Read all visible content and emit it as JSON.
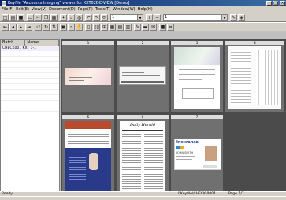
{
  "window": {
    "title": "Keyfile \"Accounts Imaging\" viewer for KXT02DC-VIEW [Demo]"
  },
  "menu": [
    "File(F)",
    "Edit(E)",
    "View(V)",
    "Document(D)",
    "Page(P)",
    "Tools(T)",
    "Window(W)",
    "Help(H)"
  ],
  "toolbar": {
    "zoom_value": "1",
    "page_value": "1"
  },
  "sidebar": {
    "columns": [
      "Batch",
      "Name"
    ],
    "rows": [
      {
        "batch": "CHECK001",
        "name": "KXT 1-1"
      }
    ]
  },
  "pages": [
    {
      "num": "1",
      "kind": "check"
    },
    {
      "num": "2",
      "kind": "check"
    },
    {
      "num": "3",
      "kind": "check"
    },
    {
      "num": "4",
      "kind": "form"
    },
    {
      "num": "5",
      "kind": "article"
    },
    {
      "num": "6",
      "kind": "newspaper"
    },
    {
      "num": "7",
      "kind": "id-card"
    }
  ],
  "card": {
    "title": "Insurance",
    "name": "JOHN SMITH"
  },
  "newspaper": {
    "masthead": "Daily Herald"
  },
  "status": {
    "left": "Ready",
    "middle": "\\\\Keyfile\\CHECK\\0001",
    "right": "Page 1/7"
  }
}
